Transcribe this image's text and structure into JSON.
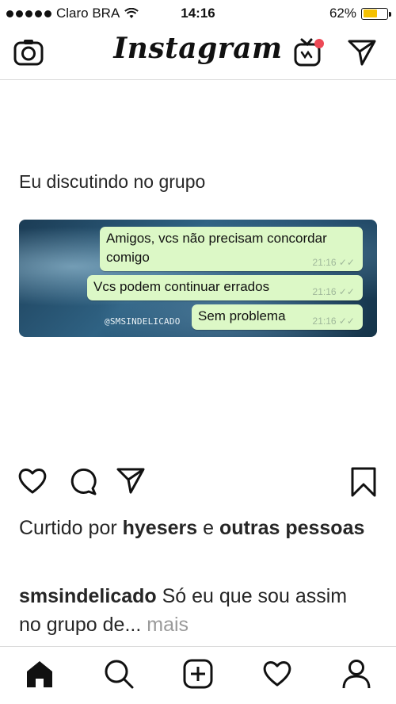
{
  "status_bar": {
    "carrier": "Claro BRA",
    "time": "14:16",
    "battery": "62%",
    "battery_level": 0.62
  },
  "header": {
    "logo": "Instagram",
    "icons": [
      "camera-icon",
      "igtv-icon",
      "direct-send-icon"
    ]
  },
  "post": {
    "image_caption": "Eu discutindo no grupo",
    "chat": [
      {
        "text": "Amigos, vcs não precisam concordar comigo",
        "time": "21:16"
      },
      {
        "text": "Vcs podem continuar errados",
        "time": "21:16"
      },
      {
        "text": "Sem problema",
        "time": "21:16"
      }
    ],
    "watermark": "@SMSINDELICADO",
    "likes": {
      "prefix": "Curtido por",
      "user": "hyesers",
      "connector": "e",
      "others": "outras pessoas"
    },
    "caption": {
      "user": "smsindelicado",
      "text": "Só eu que sou assim no grupo de...",
      "more": "mais"
    }
  },
  "actions": [
    "heart-icon",
    "comment-icon",
    "share-icon",
    "bookmark-icon"
  ],
  "nav": [
    "home-icon",
    "search-icon",
    "add-post-icon",
    "activity-heart-icon",
    "profile-icon"
  ],
  "colors": {
    "bubble": "#dcf8c6",
    "battery": "#f5c100",
    "notification": "#ed4956"
  }
}
